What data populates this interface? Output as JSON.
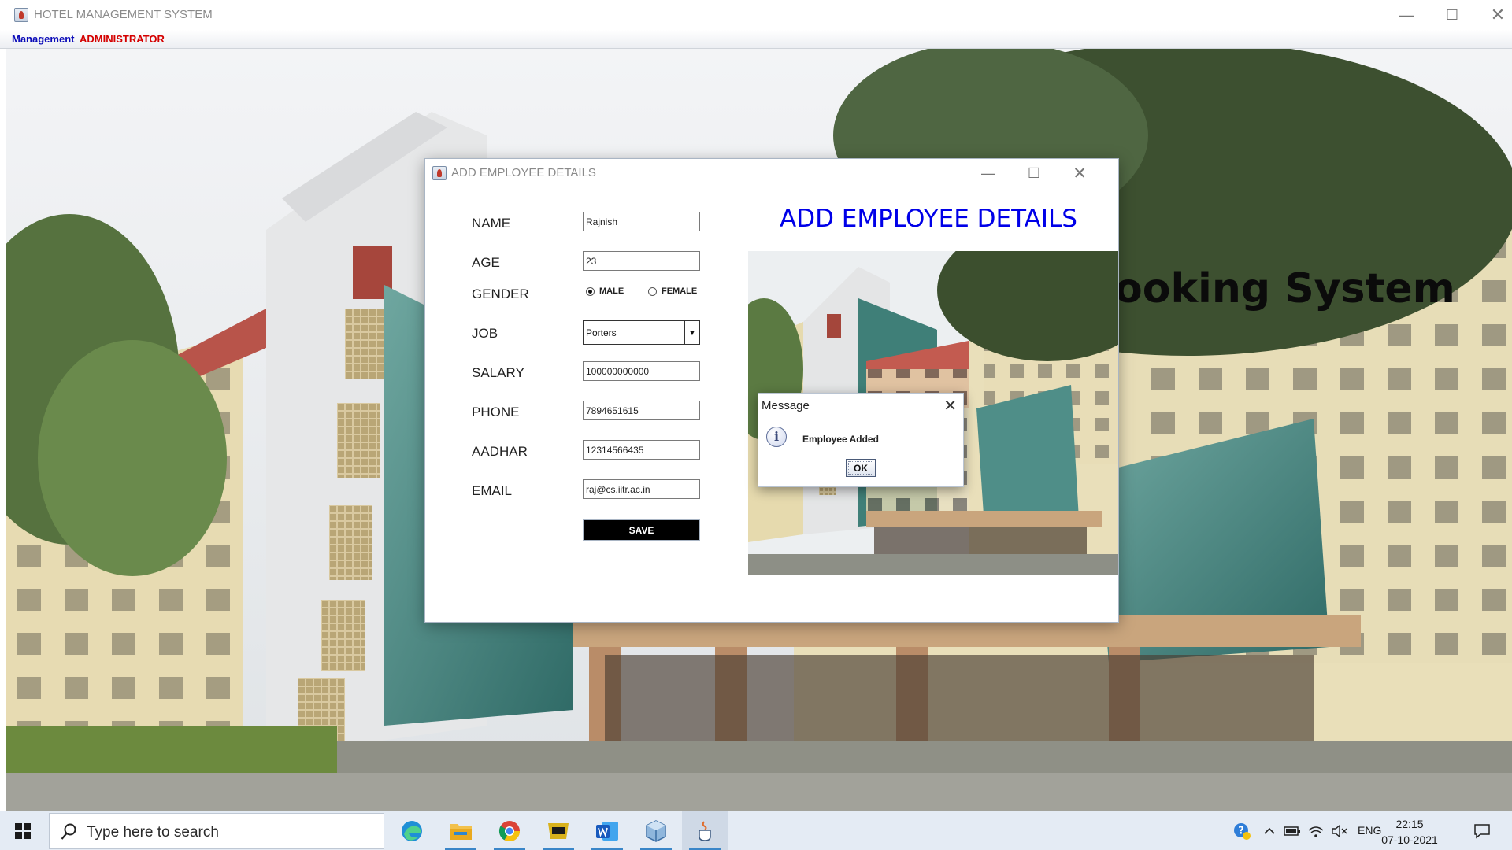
{
  "main_window": {
    "title": "HOTEL MANAGEMENT SYSTEM",
    "menu": [
      {
        "label": "Management",
        "color": "#0a0ab8"
      },
      {
        "label": "ADMINISTRATOR",
        "color": "#d40000"
      }
    ],
    "background_heading": "ooking System"
  },
  "employee_window": {
    "title": "ADD EMPLOYEE DETAILS",
    "heading": "ADD EMPLOYEE DETAILS",
    "heading_color": "#0000e8",
    "labels": {
      "name": "NAME",
      "age": "AGE",
      "gender": "GENDER",
      "job": "JOB",
      "salary": "SALARY",
      "phone": "PHONE",
      "aadhar": "AADHAR",
      "email": "EMAIL"
    },
    "values": {
      "name": "Rajnish",
      "age": "23",
      "job": "Porters",
      "salary": "100000000000",
      "phone": "7894651615",
      "aadhar": "12314566435",
      "email": "raj@cs.iitr.ac.in"
    },
    "gender_options": [
      {
        "label": "MALE",
        "selected": true
      },
      {
        "label": "FEMALE",
        "selected": false
      }
    ],
    "save_label": "SAVE"
  },
  "message_dialog": {
    "title": "Message",
    "icon": "info-icon",
    "text": "Employee Added",
    "ok_label": "OK"
  },
  "taskbar": {
    "search_placeholder": "Type here to search",
    "apps": [
      "edge-icon",
      "file-explorer-icon",
      "chrome-icon",
      "pdf-reader-icon",
      "word-icon",
      "virtualbox-icon",
      "java-icon"
    ],
    "tray": {
      "language": "ENG",
      "time": "22:15",
      "date": "07-10-2021"
    }
  }
}
